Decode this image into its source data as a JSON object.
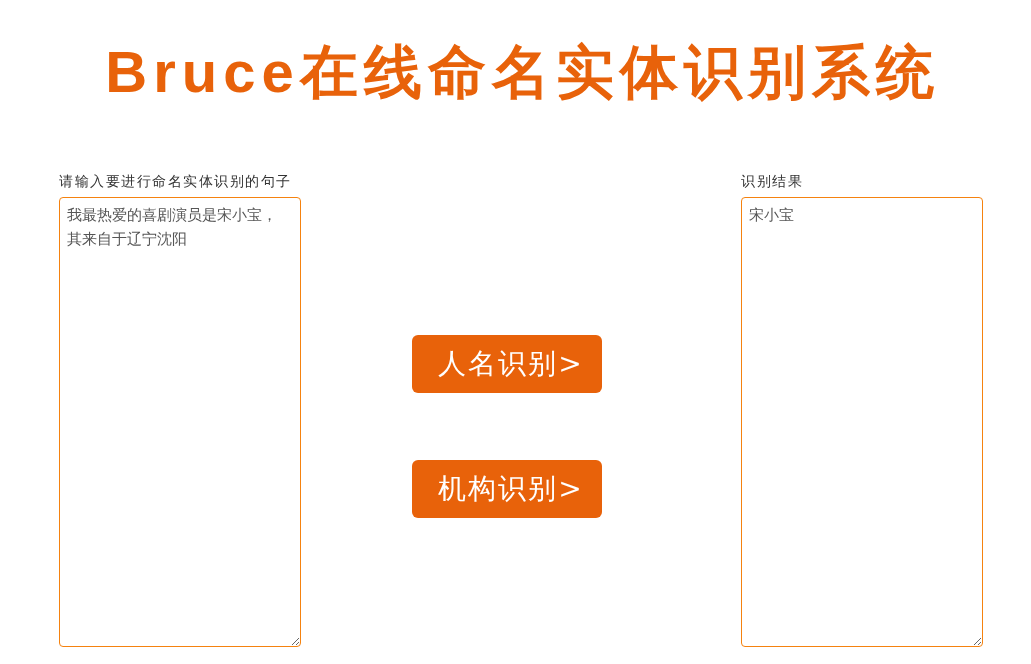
{
  "title": "Bruce在线命名实体识别系统",
  "input": {
    "label": "请输入要进行命名实体识别的句子",
    "value": "我最热爱的喜剧演员是宋小宝，其来自于辽宁沈阳"
  },
  "buttons": [
    {
      "label": "人名识别>"
    },
    {
      "label": "机构识别>"
    }
  ],
  "result": {
    "label": "识别结果",
    "value": "宋小宝"
  }
}
